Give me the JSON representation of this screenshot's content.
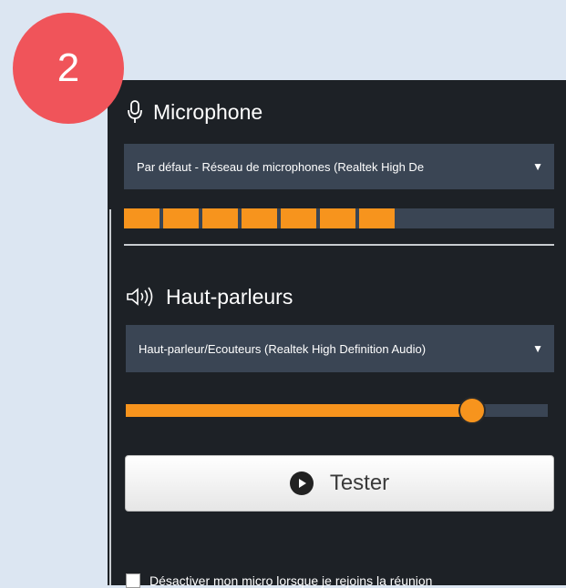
{
  "step": {
    "number": "2"
  },
  "microphone": {
    "title": "Microphone",
    "device": "Par défaut - Réseau de microphones (Realtek High De",
    "arrow": "▼",
    "level_segments_lit": 7,
    "level_segments_total": 11
  },
  "speakers": {
    "title": "Haut-parleurs",
    "device": "Haut-parleur/Ecouteurs (Realtek High Definition Audio)",
    "arrow": "▼",
    "volume_fraction": 0.82
  },
  "test_button": {
    "label": "Tester"
  },
  "mute_on_join": {
    "label": "Désactiver mon micro lorsque je rejoins la réunion",
    "checked": false
  },
  "colors": {
    "accent": "#f7941d",
    "panel": "#1d2126",
    "control": "#3a4554",
    "badge": "#f0545a"
  }
}
